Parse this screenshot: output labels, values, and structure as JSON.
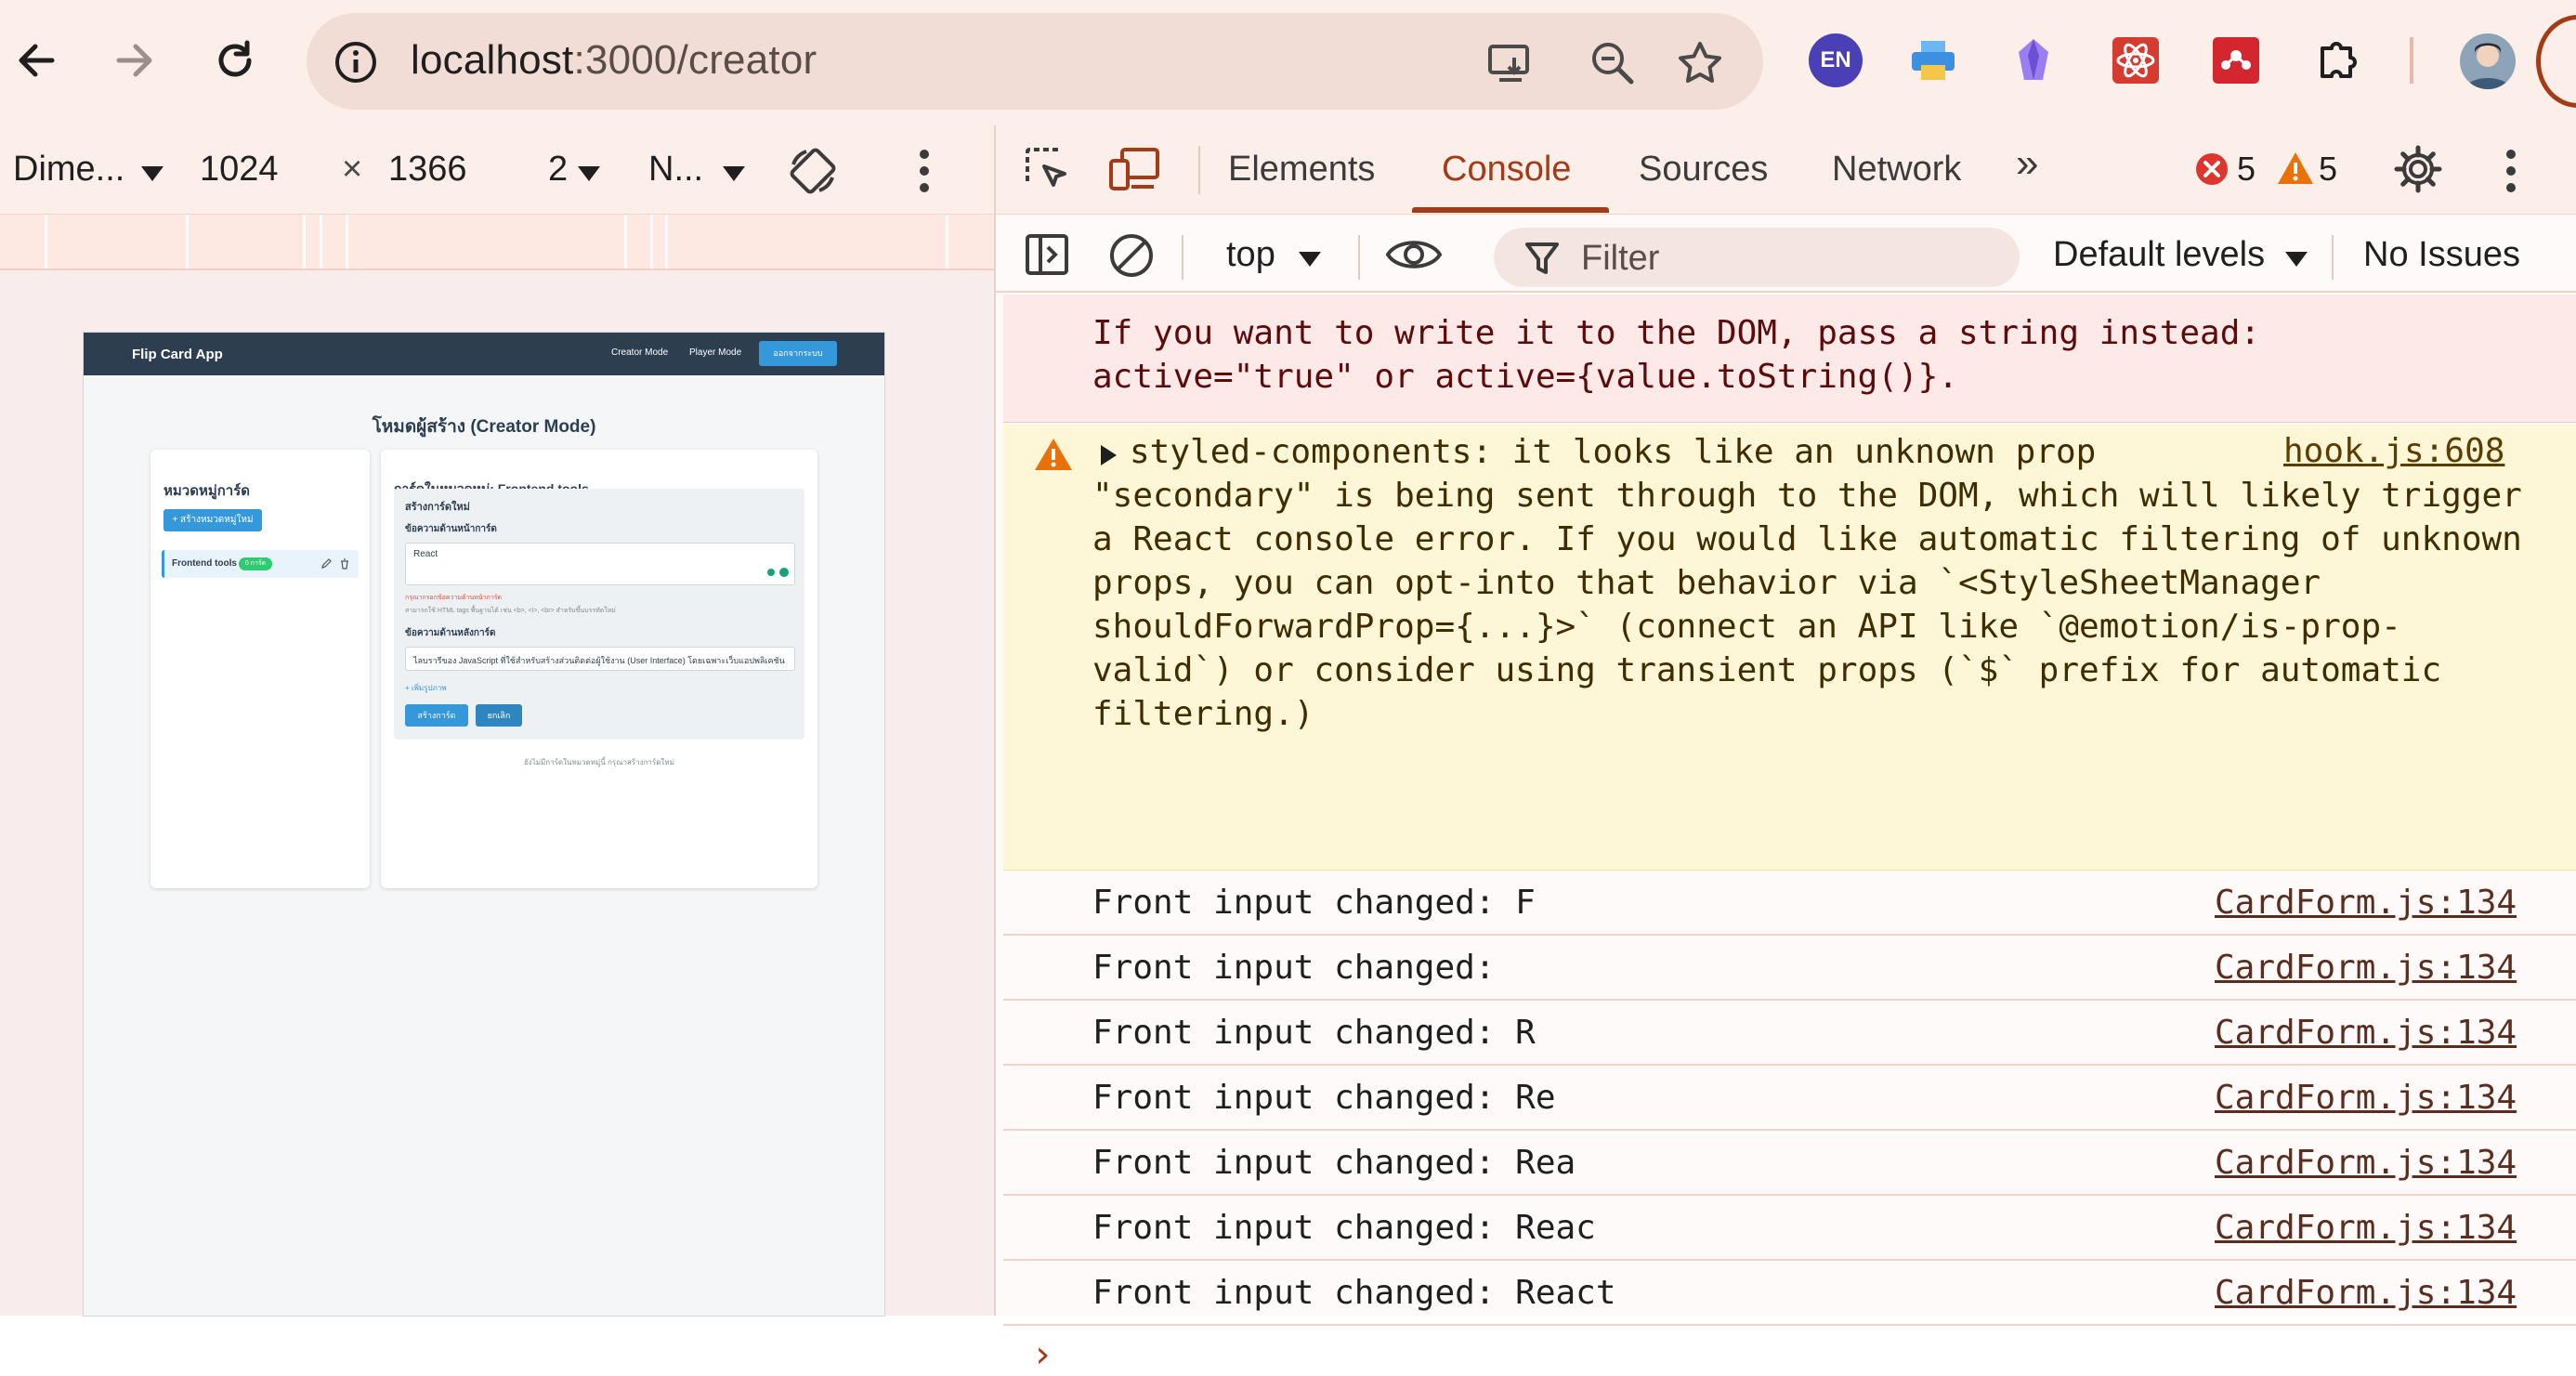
{
  "browser": {
    "url_host": "localhost",
    "url_path": ":3000/creator",
    "extension_en_label": "EN"
  },
  "device_toolbar": {
    "dimensions": "Dime...",
    "width": "1024",
    "times": "×",
    "height": "1366",
    "zoom": "2",
    "throttle": "N..."
  },
  "emulated_page": {
    "brand": "Flip Card App",
    "nav": {
      "creator": "Creator Mode",
      "player": "Player Mode",
      "logout": "ออกจากระบบ"
    },
    "title": "โหมดผู้สร้าง (Creator Mode)",
    "categories": {
      "heading": "หมวดหมู่การ์ด",
      "add_button": "+ สร้างหมวดหมู่ใหม่",
      "item_name": "Frontend tools",
      "item_badge": "0 การ์ด"
    },
    "cards": {
      "heading": "การ์ดในหมวดหมู่: Frontend tools",
      "form_title": "สร้างการ์ดใหม่",
      "front_label": "ข้อความด้านหน้าการ์ด",
      "front_value": "React",
      "front_error": "กรุณากรอกข้อความด้านหน้าการ์ด",
      "front_hint": "สามารถใช้ HTML tags พื้นฐานได้ เช่น <b>, <i>, <br> สำหรับขึ้นบรรทัดใหม่",
      "back_label": "ข้อความด้านหลังการ์ด",
      "back_value": "ไลบรารีของ JavaScript ที่ใช้สำหรับสร้างส่วนติดต่อผู้ใช้งาน (User Interface) โดยเฉพาะเว็บแอปพลิเคชัน",
      "add_image": "+ เพิ่มรูปภาพ",
      "create_button": "สร้างการ์ด",
      "cancel_button": "ยกเลิก",
      "empty_text": "ยังไม่มีการ์ดในหมวดหมู่นี้ กรุณาสร้างการ์ดใหม่"
    }
  },
  "devtools": {
    "tabs": [
      "Elements",
      "Console",
      "Sources",
      "Network"
    ],
    "more_tabs": "»",
    "error_count": "5",
    "warning_count": "5",
    "context": "top",
    "filter_placeholder": "Filter",
    "levels": "Default levels",
    "issues": "No Issues",
    "error_message": {
      "lines": [
        "If you want to write it to the DOM, pass a string instead:",
        "active=\"true\" or active={value.toString()}."
      ]
    },
    "warning_message": {
      "source": "hook.js:608",
      "lines": [
        "styled-components: it looks like an unknown prop",
        "\"secondary\" is being sent through to the DOM, which will likely trigger",
        "a React console error. If you would like automatic filtering of unknown",
        "props, you can opt-into that behavior via `<StyleSheetManager",
        "shouldForwardProp={...}>` (connect an API like `@emotion/is-prop-",
        "valid`) or consider using transient props (`$` prefix for automatic",
        "filtering.)"
      ]
    },
    "logs": [
      {
        "text": "Front input changed: F",
        "source": "CardForm.js:134"
      },
      {
        "text": "Front input changed: ",
        "source": "CardForm.js:134"
      },
      {
        "text": "Front input changed: R",
        "source": "CardForm.js:134"
      },
      {
        "text": "Front input changed: Re",
        "source": "CardForm.js:134"
      },
      {
        "text": "Front input changed: Rea",
        "source": "CardForm.js:134"
      },
      {
        "text": "Front input changed: Reac",
        "source": "CardForm.js:134"
      },
      {
        "text": "Front input changed: React",
        "source": "CardForm.js:134"
      }
    ],
    "prompt": "›"
  },
  "colors": {
    "accent": "#a33b17",
    "error_bg": "#fce9e8",
    "warning_bg": "#fdf6d7",
    "emulated_nav": "#2c3e50",
    "emulated_button": "#3498db"
  }
}
